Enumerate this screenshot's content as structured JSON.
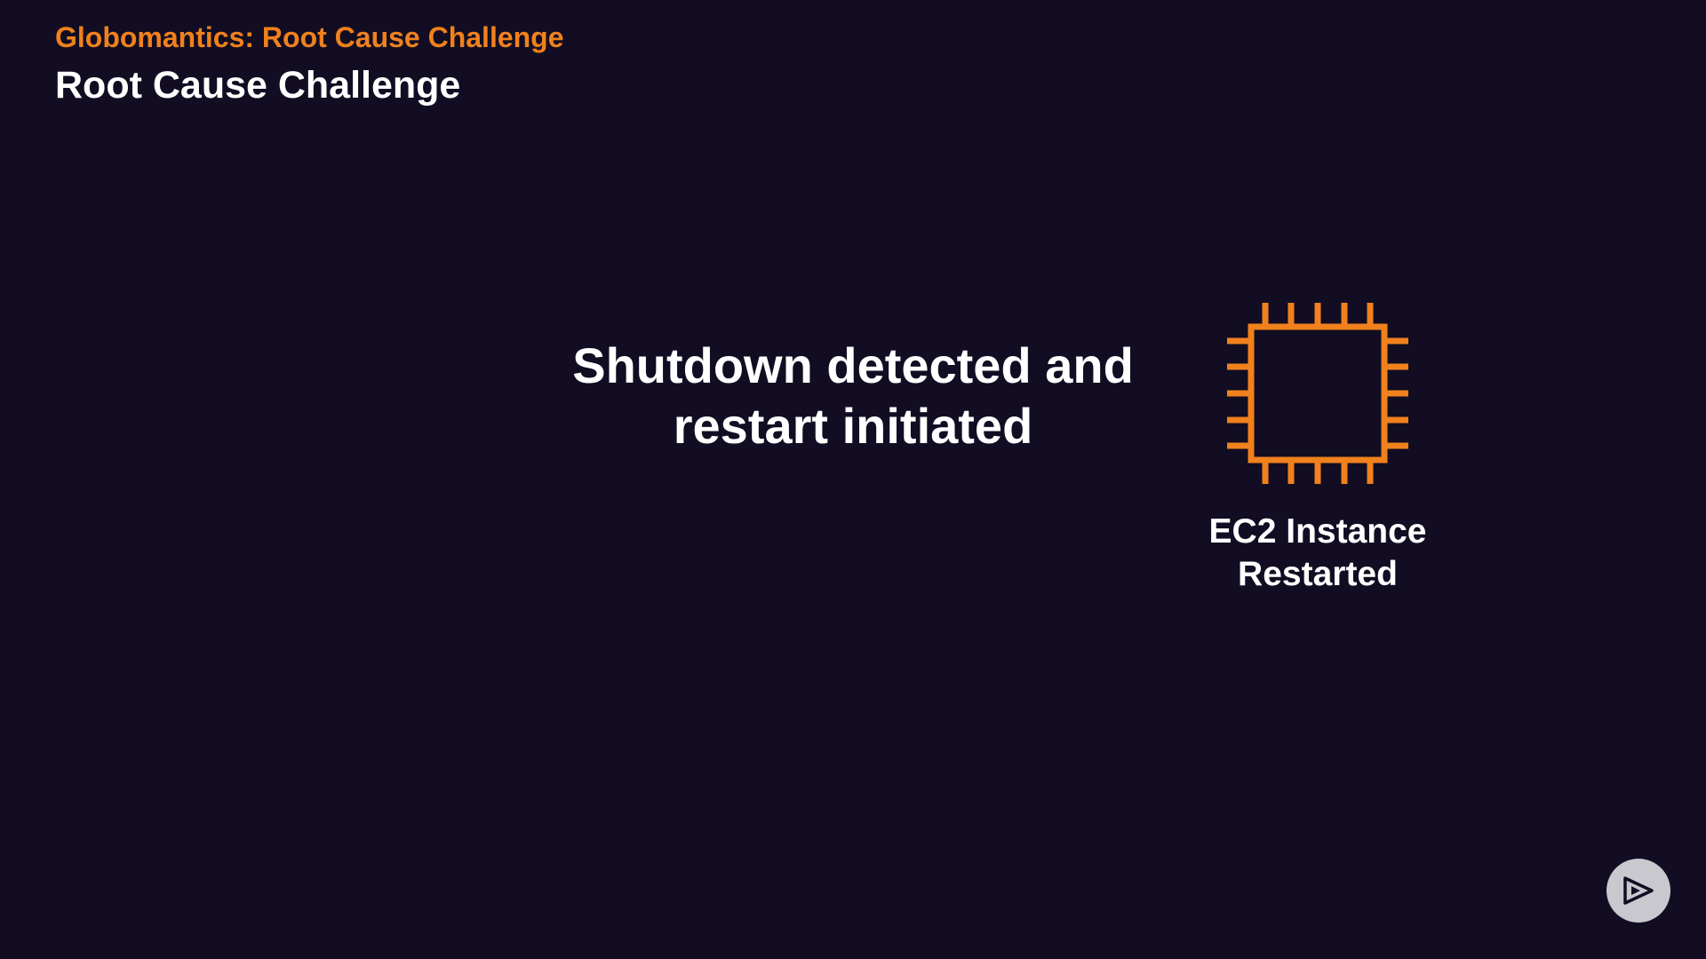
{
  "header": {
    "eyebrow": "Globomantics: Root Cause Challenge",
    "title": "Root Cause Challenge"
  },
  "main": {
    "message_line1": "Shutdown detected and",
    "message_line2": "restart initiated"
  },
  "ec2": {
    "icon": "ec2-chip-icon",
    "label_line1": "EC2 Instance",
    "label_line2": "Restarted"
  },
  "controls": {
    "play_icon": "play-icon"
  },
  "colors": {
    "background": "#120d22",
    "accent": "#f0811d",
    "text": "#ffffff",
    "button": "#c9c8cf"
  }
}
